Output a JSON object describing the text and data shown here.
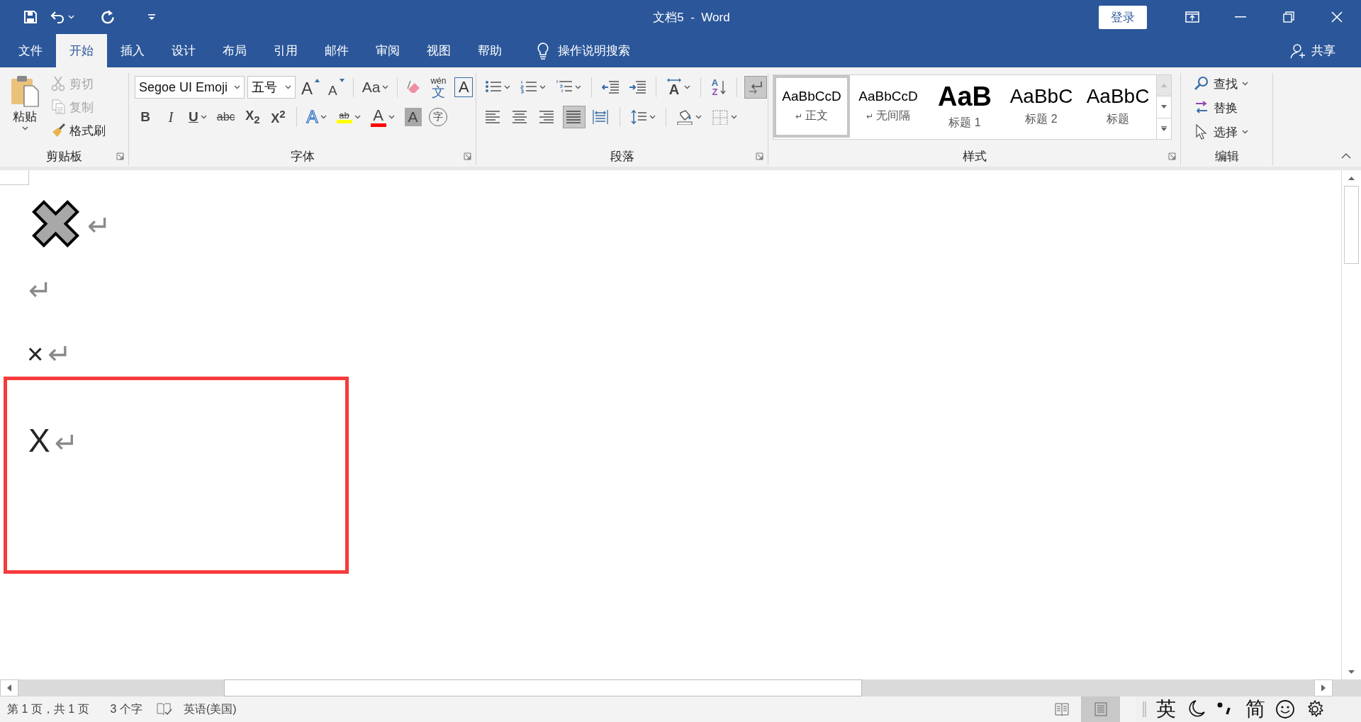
{
  "window": {
    "title": "文档5  -  Word",
    "sign_in": "登录"
  },
  "tabs": [
    {
      "label": "文件",
      "selected": false
    },
    {
      "label": "开始",
      "selected": true
    },
    {
      "label": "插入",
      "selected": false
    },
    {
      "label": "设计",
      "selected": false
    },
    {
      "label": "布局",
      "selected": false
    },
    {
      "label": "引用",
      "selected": false
    },
    {
      "label": "邮件",
      "selected": false
    },
    {
      "label": "审阅",
      "selected": false
    },
    {
      "label": "视图",
      "selected": false
    },
    {
      "label": "帮助",
      "selected": false
    }
  ],
  "tell_me": "操作说明搜索",
  "share": "共享",
  "clipboard": {
    "title": "剪贴板",
    "paste": "粘贴",
    "commands": [
      {
        "kind": "cut",
        "label": "剪切",
        "disabled": true
      },
      {
        "kind": "copy",
        "label": "复制",
        "disabled": true
      },
      {
        "kind": "painter",
        "label": "格式刷",
        "disabled": false
      }
    ]
  },
  "font": {
    "title": "字体",
    "font_name": "Segoe UI Emoji",
    "font_size": "五号",
    "row1": [
      {
        "kind": "grow",
        "text": "A"
      },
      {
        "kind": "shrink",
        "text": "A"
      },
      {
        "kind": "separator"
      },
      {
        "kind": "case",
        "text": "Aa"
      },
      {
        "kind": "separator"
      },
      {
        "kind": "clear"
      },
      {
        "kind": "phonetic",
        "text": "wén",
        "sub": "文"
      },
      {
        "kind": "border",
        "text": "A"
      }
    ],
    "row2": [
      {
        "kind": "bold",
        "text": "B"
      },
      {
        "kind": "italic",
        "text": "I"
      },
      {
        "kind": "underline",
        "text": "U"
      },
      {
        "kind": "strike",
        "text": "abc"
      },
      {
        "kind": "subscript",
        "text": "X$_{2}$"
      },
      {
        "kind": "superscript",
        "text": "X$^{2}$"
      },
      {
        "kind": "separator"
      },
      {
        "kind": "effects",
        "text": "A"
      },
      {
        "kind": "highlight",
        "text": "ab",
        "color": "#ffff00"
      },
      {
        "kind": "color",
        "text": "A",
        "color": "#ff0000"
      },
      {
        "kind": "shading",
        "text": "A"
      },
      {
        "kind": "enclose",
        "text": "字"
      }
    ]
  },
  "paragraph": {
    "title": "段落",
    "row1": [
      {
        "kind": "bullets",
        "on": false
      },
      {
        "kind": "numbering",
        "on": false
      },
      {
        "kind": "multilevel",
        "on": false
      },
      {
        "kind": "separator"
      },
      {
        "kind": "outdent",
        "on": false
      },
      {
        "kind": "indent",
        "on": false
      },
      {
        "kind": "separator"
      },
      {
        "kind": "direction",
        "text": "A",
        "on": false
      },
      {
        "kind": "separator"
      },
      {
        "kind": "sort",
        "text": "A",
        "sub": "Z",
        "on": false
      },
      {
        "kind": "separator"
      },
      {
        "kind": "marks",
        "on": true
      }
    ],
    "row2": [
      {
        "kind": "align_left",
        "on": false
      },
      {
        "kind": "align_center",
        "on": false
      },
      {
        "kind": "align_right",
        "on": false
      },
      {
        "kind": "justify",
        "on": true
      },
      {
        "kind": "distributed",
        "on": false
      },
      {
        "kind": "separator"
      },
      {
        "kind": "line_spacing",
        "on": false
      },
      {
        "kind": "separator"
      },
      {
        "kind": "shading",
        "on": false
      },
      {
        "kind": "borders",
        "on": false
      }
    ]
  },
  "styles": {
    "title": "样式",
    "items": [
      {
        "kind": "normal",
        "preview": "AaBbCcD",
        "para_mark": "↵",
        "name": "正文",
        "selected": true
      },
      {
        "kind": "no_spacing",
        "preview": "AaBbCcD",
        "para_mark": "↵",
        "name": "无间隔",
        "selected": false
      },
      {
        "kind": "heading1",
        "preview": "AaB",
        "name": "标题 1",
        "selected": false
      },
      {
        "kind": "heading2",
        "preview": "AaBbC",
        "name": "标题 2",
        "selected": false
      },
      {
        "kind": "title",
        "preview": "AaBbC",
        "name": "标题",
        "selected": false
      }
    ]
  },
  "editing": {
    "title": "编辑",
    "commands": [
      {
        "kind": "find",
        "label": "查找"
      },
      {
        "kind": "replace",
        "label": "替换"
      },
      {
        "kind": "select",
        "label": "选择"
      }
    ]
  },
  "document": {
    "paragraphs": [
      {
        "kind": "emoji",
        "text": "✖",
        "mark": "↵",
        "framed": false
      },
      {
        "kind": "empty",
        "mark": "↵",
        "framed": false
      },
      {
        "kind": "symbol",
        "text": "×",
        "mark": "↵",
        "framed": false
      },
      {
        "kind": "letter",
        "text": "X",
        "mark": "↵",
        "framed": true
      }
    ]
  },
  "status_bar": {
    "page": "第 1 页，共 1 页",
    "words": "3 个字",
    "language": "英语(美国)",
    "views": [
      {
        "kind": "read",
        "selected": false
      },
      {
        "kind": "print",
        "selected": true
      }
    ]
  },
  "ime": {
    "items": [
      {
        "kind": "text",
        "text": "英"
      },
      {
        "kind": "moon"
      },
      {
        "kind": "punctuation"
      },
      {
        "kind": "text",
        "text": "简"
      },
      {
        "kind": "emoji"
      },
      {
        "kind": "settings"
      }
    ]
  }
}
